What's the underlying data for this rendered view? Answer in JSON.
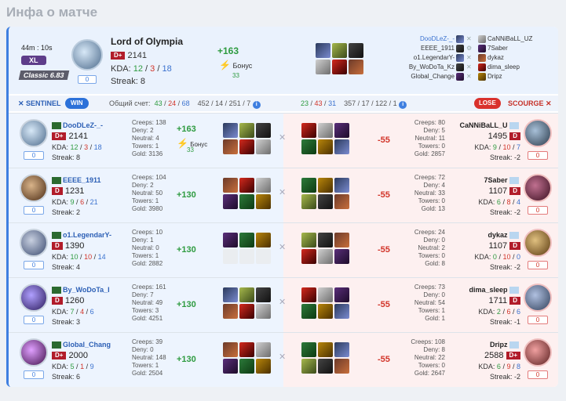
{
  "page_title": "Инфа о матче",
  "header": {
    "duration": "44m : 10s",
    "league": "XL",
    "mode": "Classic 6.83",
    "mvp": {
      "name": "Lord of Olympia",
      "rank": "D+",
      "rating": "2141",
      "kda_label": "KDA:",
      "kills": "12",
      "deaths": "3",
      "assists": "18",
      "streak_label": "Streak:",
      "streak": "8",
      "box": "0",
      "gain": "+163",
      "bonus_label": "Бонус",
      "bonus": "33"
    },
    "sentinel_players": [
      "DooDLeZ-_-",
      "EEEE_1911",
      "o1.LegendarY-",
      "By_WoDoTa_Kz",
      "Global_Change"
    ],
    "scourge_players": [
      "CaNNiBaLL_UZ",
      "7Saber",
      "dykaz",
      "dima_sleep",
      "Dripz"
    ]
  },
  "score": {
    "sentinel_label": "SENTINEL",
    "win": "WIN",
    "total_label": "Общий счет:",
    "s_kills": "43",
    "s_deaths": "24",
    "s_assists": "68",
    "s_extra": "452 / 14 / 251 / 7",
    "c_kills": "23",
    "c_deaths": "43",
    "c_assists": "31",
    "c_extra": "357 / 17 / 122 / 1",
    "lose": "LOSE",
    "scourge_label": "SCOURGE"
  },
  "labels": {
    "kda": "KDA:",
    "streak": "Streak:",
    "creeps": "Creeps:",
    "deny": "Deny:",
    "neutral": "Neutral:",
    "towers": "Towers:",
    "gold": "Gold:",
    "bonus": "Бонус"
  },
  "rows": [
    {
      "l": {
        "name": "DooDLeZ-_-",
        "rank": "D+",
        "rating": "2141",
        "k": "12",
        "d": "3",
        "a": "18",
        "streak": "8",
        "box": "0",
        "creeps": "138",
        "deny": "2",
        "neutral": "4",
        "towers": "1",
        "gold": "3136",
        "gain": "+163",
        "bonus": "33"
      },
      "r": {
        "name": "CaNNiBaLL_U",
        "rank": "D",
        "rating": "1495",
        "k": "9",
        "d": "10",
        "a": "7",
        "streak": "-2",
        "box": "0",
        "creeps": "80",
        "deny": "5",
        "neutral": "11",
        "towers": "0",
        "gold": "2857",
        "gain": "-55"
      }
    },
    {
      "l": {
        "name": "EEEE_1911",
        "rank": "D",
        "rating": "1231",
        "k": "9",
        "d": "6",
        "a": "21",
        "streak": "2",
        "box": "0",
        "creeps": "104",
        "deny": "2",
        "neutral": "50",
        "towers": "1",
        "gold": "3980",
        "gain": "+130"
      },
      "r": {
        "name": "7Saber",
        "rank": "D",
        "rating": "1107",
        "k": "6",
        "d": "8",
        "a": "4",
        "streak": "-2",
        "box": "0",
        "creeps": "72",
        "deny": "4",
        "neutral": "33",
        "towers": "0",
        "gold": "13",
        "gain": "-55"
      }
    },
    {
      "l": {
        "name": "o1.LegendarY-",
        "rank": "D",
        "rating": "1390",
        "k": "10",
        "d": "10",
        "a": "14",
        "streak": "4",
        "box": "0",
        "creeps": "10",
        "deny": "1",
        "neutral": "0",
        "towers": "1",
        "gold": "2882",
        "gain": "+130"
      },
      "r": {
        "name": "dykaz",
        "rank": "D",
        "rating": "1107",
        "k": "0",
        "d": "10",
        "a": "0",
        "streak": "-2",
        "box": "0",
        "creeps": "24",
        "deny": "0",
        "neutral": "2",
        "towers": "0",
        "gold": "8",
        "gain": "-55"
      }
    },
    {
      "l": {
        "name": "By_WoDoTa_I",
        "rank": "D",
        "rating": "1260",
        "k": "7",
        "d": "4",
        "a": "6",
        "streak": "3",
        "box": "0",
        "creeps": "161",
        "deny": "7",
        "neutral": "49",
        "towers": "3",
        "gold": "4251",
        "gain": "+130"
      },
      "r": {
        "name": "dima_sleep",
        "rank": "D",
        "rating": "1711",
        "k": "2",
        "d": "6",
        "a": "6",
        "streak": "-1",
        "box": "0",
        "creeps": "73",
        "deny": "0",
        "neutral": "54",
        "towers": "1",
        "gold": "1",
        "gain": "-55"
      }
    },
    {
      "l": {
        "name": "Global_Chang",
        "rank": "D+",
        "rating": "2000",
        "k": "5",
        "d": "1",
        "a": "9",
        "streak": "6",
        "box": "0",
        "creeps": "39",
        "deny": "0",
        "neutral": "148",
        "towers": "1",
        "gold": "2504",
        "gain": "+130"
      },
      "r": {
        "name": "Dripz",
        "rank": "D+",
        "rating": "2588",
        "k": "6",
        "d": "9",
        "a": "8",
        "streak": "-2",
        "box": "0",
        "creeps": "108",
        "deny": "8",
        "neutral": "22",
        "towers": "0",
        "gold": "2647",
        "gain": "-55"
      }
    }
  ]
}
